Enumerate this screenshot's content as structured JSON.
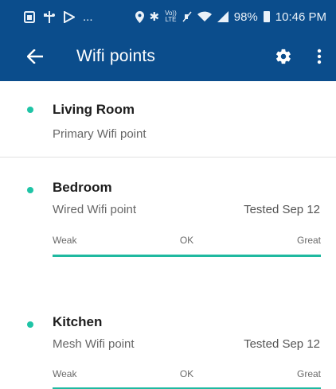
{
  "status_bar": {
    "left_more": "...",
    "volte_top": "Vo))",
    "volte_bottom": "LTE",
    "battery": "98%",
    "time": "10:46 PM"
  },
  "toolbar": {
    "title": "Wifi points",
    "back_icon": "arrow-back-icon",
    "settings_icon": "gear-icon",
    "more_icon": "more-vert-icon"
  },
  "colors": {
    "app_bar": "#0b4d8c",
    "accent": "#1fc4a6",
    "signal_bar": "#1fb9a0"
  },
  "wifi_points": [
    {
      "name": "Living Room",
      "type": "Primary Wifi point"
    },
    {
      "name": "Bedroom",
      "type": "Wired Wifi point",
      "tested": "Tested Sep 12",
      "scale": {
        "weak": "Weak",
        "ok": "OK",
        "great": "Great"
      },
      "signal_level": 1.0
    },
    {
      "name": "Kitchen",
      "type": "Mesh Wifi point",
      "tested": "Tested Sep 12",
      "scale": {
        "weak": "Weak",
        "ok": "OK",
        "great": "Great"
      },
      "signal_level": 1.0
    }
  ]
}
